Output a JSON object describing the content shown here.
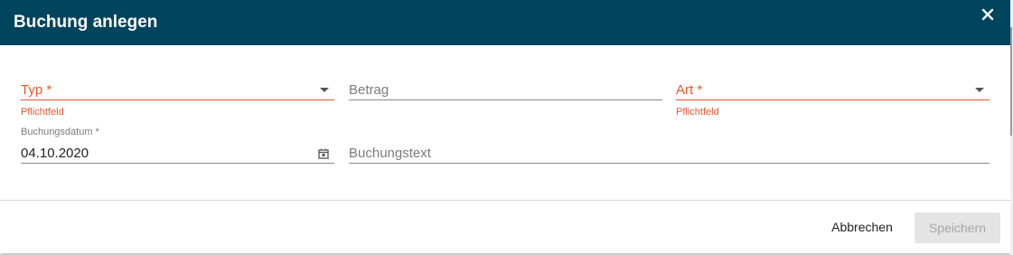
{
  "dialog": {
    "title": "Buchung anlegen",
    "close_icon": "close-icon"
  },
  "form": {
    "typ": {
      "label": "Typ *",
      "hint": "Pflichtfeld",
      "value": ""
    },
    "betrag": {
      "label": "Betrag",
      "value": ""
    },
    "art": {
      "label": "Art *",
      "hint": "Pflichtfeld",
      "value": ""
    },
    "buchungsdatum": {
      "label": "Buchungsdatum *",
      "value": "04.10.2020",
      "icon": "calendar-icon"
    },
    "buchungstext": {
      "label": "Buchungstext",
      "value": ""
    }
  },
  "actions": {
    "cancel_label": "Abbrechen",
    "save_label": "Speichern"
  },
  "colors": {
    "header": "#00445e",
    "error": "#e8562c",
    "disabled_bg": "#e4e4e4"
  }
}
